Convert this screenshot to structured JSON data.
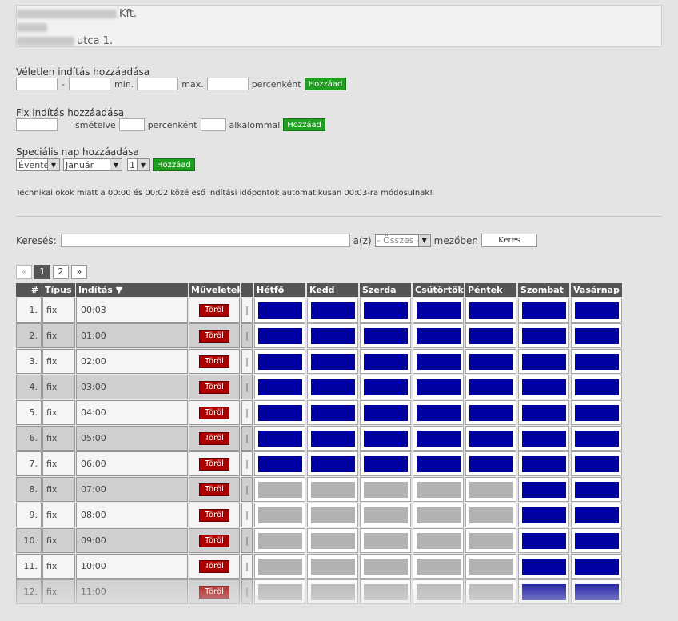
{
  "address": {
    "line1_visible": "Kft.",
    "line2_visible": "",
    "line3_visible": "utca 1."
  },
  "random_start": {
    "title": "Véletlen indítás hozzáadása",
    "dash": "-",
    "min_label": "min.",
    "max_label": "max.",
    "per_label": "percenként",
    "button": "Hozzáad"
  },
  "fixed_start": {
    "title": "Fix indítás hozzáadása",
    "repeat_label": "ismételve",
    "per_label": "percenként",
    "times_label": "alkalommal",
    "button": "Hozzáad"
  },
  "special_day": {
    "title": "Speciális nap hozzáadása",
    "frequency_value": "Évente",
    "month_value": "Január",
    "day_value": "1",
    "button": "Hozzáad"
  },
  "notice": "Technikai okok miatt a 00:00 és 00:02 közé eső indítási időpontok automatikusan 00:03-ra módosulnak!",
  "search": {
    "label": "Keresés:",
    "value": "",
    "az_label": "a(z)",
    "field_value": "- Összes -",
    "field_suffix": "mezőben",
    "button": "Keres"
  },
  "pagination": {
    "prev": "«",
    "pages": [
      "1",
      "2"
    ],
    "active": "1",
    "next": "»"
  },
  "table": {
    "columns": {
      "num": "#",
      "type": "Típus",
      "start": "Indítás ▼",
      "actions": "Műveletek",
      "days": [
        "Hétfő",
        "Kedd",
        "Szerda",
        "Csütörtök",
        "Péntek",
        "Szombat",
        "Vasárnap"
      ]
    },
    "delete_label": "Töröl",
    "separator": "|",
    "rows": [
      {
        "num": "1.",
        "type": "fix",
        "time": "00:03",
        "days": [
          true,
          true,
          true,
          true,
          true,
          true,
          true
        ]
      },
      {
        "num": "2.",
        "type": "fix",
        "time": "01:00",
        "days": [
          true,
          true,
          true,
          true,
          true,
          true,
          true
        ]
      },
      {
        "num": "3.",
        "type": "fix",
        "time": "02:00",
        "days": [
          true,
          true,
          true,
          true,
          true,
          true,
          true
        ]
      },
      {
        "num": "4.",
        "type": "fix",
        "time": "03:00",
        "days": [
          true,
          true,
          true,
          true,
          true,
          true,
          true
        ]
      },
      {
        "num": "5.",
        "type": "fix",
        "time": "04:00",
        "days": [
          true,
          true,
          true,
          true,
          true,
          true,
          true
        ]
      },
      {
        "num": "6.",
        "type": "fix",
        "time": "05:00",
        "days": [
          true,
          true,
          true,
          true,
          true,
          true,
          true
        ]
      },
      {
        "num": "7.",
        "type": "fix",
        "time": "06:00",
        "days": [
          true,
          true,
          true,
          true,
          true,
          true,
          true
        ]
      },
      {
        "num": "8.",
        "type": "fix",
        "time": "07:00",
        "days": [
          false,
          false,
          false,
          false,
          false,
          true,
          true
        ]
      },
      {
        "num": "9.",
        "type": "fix",
        "time": "08:00",
        "days": [
          false,
          false,
          false,
          false,
          false,
          true,
          true
        ]
      },
      {
        "num": "10.",
        "type": "fix",
        "time": "09:00",
        "days": [
          false,
          false,
          false,
          false,
          false,
          true,
          true
        ]
      },
      {
        "num": "11.",
        "type": "fix",
        "time": "10:00",
        "days": [
          false,
          false,
          false,
          false,
          false,
          true,
          true
        ]
      },
      {
        "num": "12.",
        "type": "fix",
        "time": "11:00",
        "days": [
          false,
          false,
          false,
          false,
          false,
          true,
          true
        ]
      }
    ]
  },
  "colors": {
    "active_day": "#0000a0",
    "inactive_day": "#b2b2b2",
    "button_green": "#1f9e1f",
    "delete_red": "#aa0000",
    "header_bg": "#555555"
  }
}
